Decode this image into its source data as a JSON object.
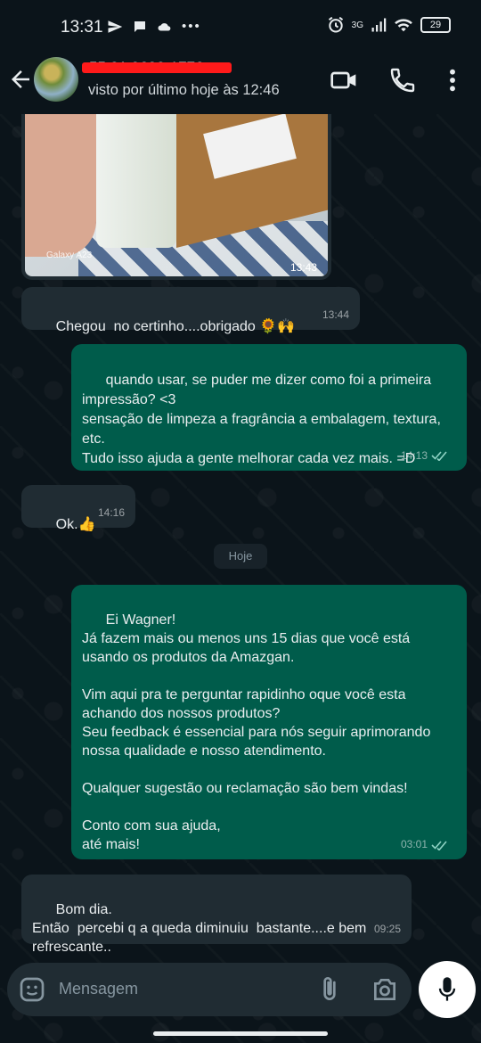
{
  "status_bar": {
    "time": "13:31",
    "left_icons": [
      "send-icon",
      "chat-icon",
      "cloud-icon",
      "more-dots"
    ],
    "network_label": "3G",
    "battery": "29"
  },
  "header": {
    "contact_name": "55 21 9682-1776",
    "last_seen": "visto por último hoje às 12:46"
  },
  "messages": [
    {
      "type": "image",
      "direction": "in",
      "camera_watermark": "Galaxy A23",
      "time": "13:43"
    },
    {
      "type": "text",
      "direction": "in",
      "text": "Chegou  no certinho....obrigado 🌻🙌",
      "time": "13:44"
    },
    {
      "type": "text",
      "direction": "out",
      "text": "quando usar, se puder me dizer como foi a primeira impressão? <3\nsensação de limpeza a fragrância a embalagem, textura, etc.\nTudo isso ajuda a gente melhorar cada vez mais. =D",
      "time": "14:13",
      "status": "read"
    },
    {
      "type": "text",
      "direction": "in",
      "text": "Ok.👍",
      "time": "14:16"
    },
    {
      "type": "text",
      "direction": "out",
      "text": "Ei Wagner!\nJá fazem mais ou menos uns 15 dias que você está usando os produtos da Amazgan.\n\nVim aqui pra te perguntar rapidinho oque você esta achando dos nossos produtos?\nSeu feedback é essencial para nós seguir aprimorando nossa qualidade e nosso atendimento.\n\nQualquer sugestão ou reclamação são bem vindas!\n\nConto com sua ajuda,\naté mais!",
      "time": "03:01",
      "status": "read"
    },
    {
      "type": "text",
      "direction": "in",
      "text": "Bom dia.\nEntão  percebi q a queda diminuiu  bastante....e bem refrescante..",
      "time": "09:25"
    }
  ],
  "date_divider": "Hoje",
  "composer": {
    "placeholder": "Mensagem"
  },
  "colors": {
    "background": "#0b141a",
    "incoming_bubble": "#202c33",
    "outgoing_bubble": "#005c4b",
    "read_ticks": "#8fd3c4",
    "redaction": "#ff1a1a"
  }
}
